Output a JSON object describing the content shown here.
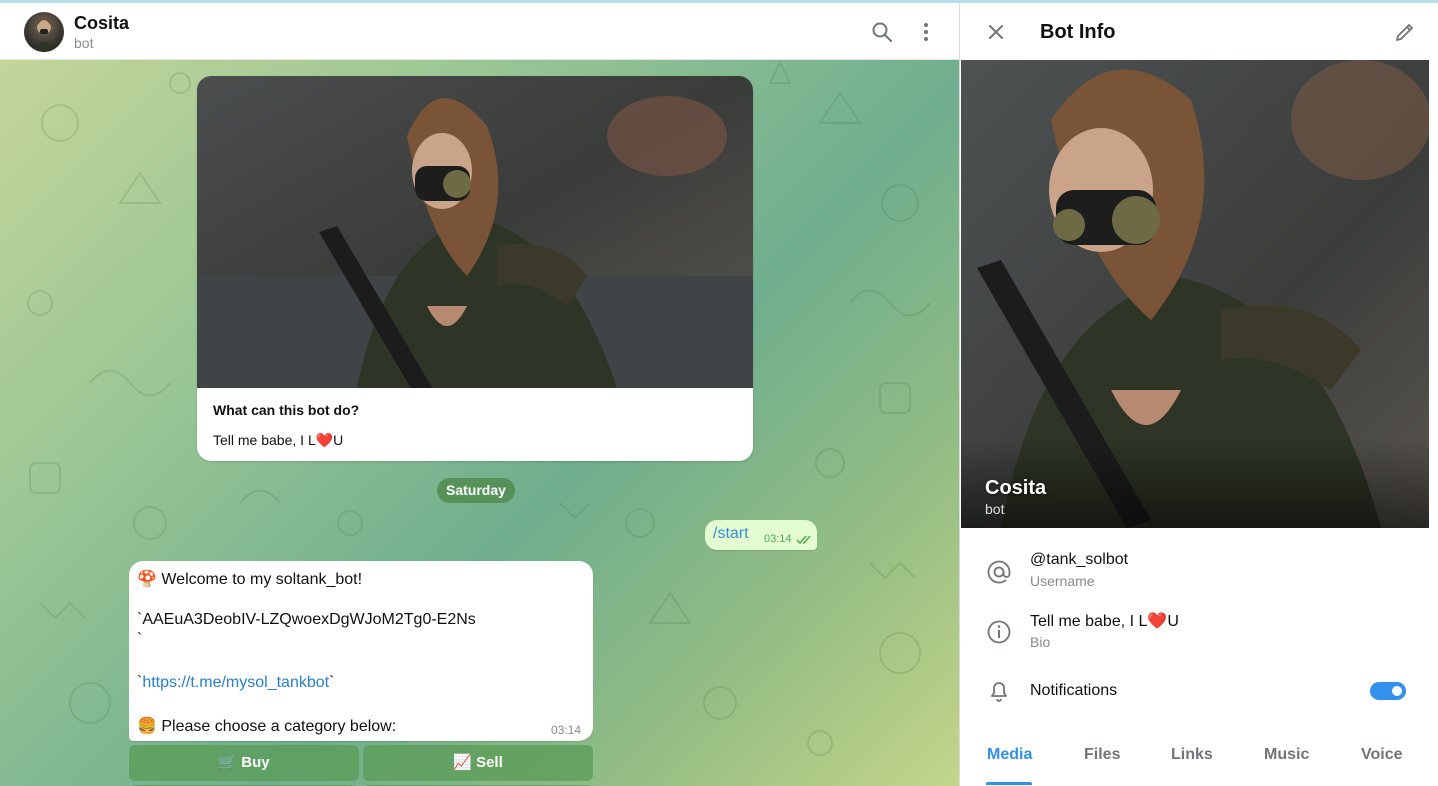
{
  "chat": {
    "title": "Cosita",
    "subtitle": "bot",
    "header_icons": [
      "search-icon",
      "more-vertical-icon"
    ]
  },
  "intro": {
    "question": "What can this bot do?",
    "bio": "Tell me babe, I L❤️U"
  },
  "date_separator": "Saturday",
  "outgoing": {
    "text": "/start",
    "time": "03:14",
    "status": "read"
  },
  "incoming": {
    "line1": "🍄 Welcome to my soltank_bot!",
    "line2": "`AAEuA3DeobIV-LZQwoexDgWJoM2Tg0-E2Ns",
    "line3": "`",
    "line4_prefix": "`",
    "link": "https://t.me/mysol_tankbot",
    "line4_suffix": "`",
    "line5": "🍔 Please choose a category below:",
    "time": "03:14"
  },
  "keyboard": {
    "buttons": [
      "🛒 Buy",
      "📈 Sell"
    ]
  },
  "info": {
    "title": "Bot Info",
    "name": "Cosita",
    "subtitle": "bot",
    "username": "@tank_solbot",
    "username_label": "Username",
    "bio": "Tell me babe, I L❤️U",
    "bio_label": "Bio",
    "notifications_label": "Notifications",
    "notifications_on": true,
    "tabs": [
      "Media",
      "Files",
      "Links",
      "Music",
      "Voice"
    ],
    "active_tab": "Media"
  },
  "colors": {
    "accent": "#3390ec",
    "outgoing_bubble": "#e3fdd0",
    "date_pill": "#508c50"
  }
}
